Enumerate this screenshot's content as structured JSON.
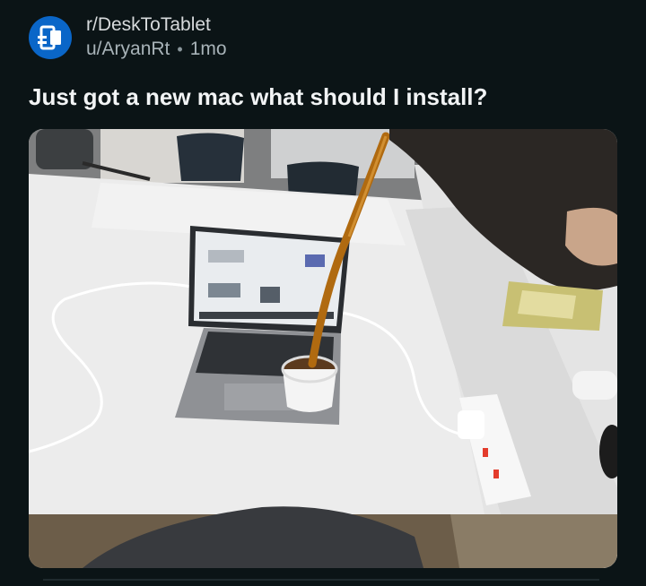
{
  "post": {
    "subreddit": "r/DeskToTablet",
    "author": "u/AryanRt",
    "separator": "•",
    "age": "1mo",
    "title": "Just got a new mac what should I install?",
    "media_icon": "photo-icon"
  },
  "colors": {
    "background": "#0b1416",
    "avatar": "#0a66c8",
    "title": "#f2f4f5",
    "meta": "#a8b3b8"
  }
}
